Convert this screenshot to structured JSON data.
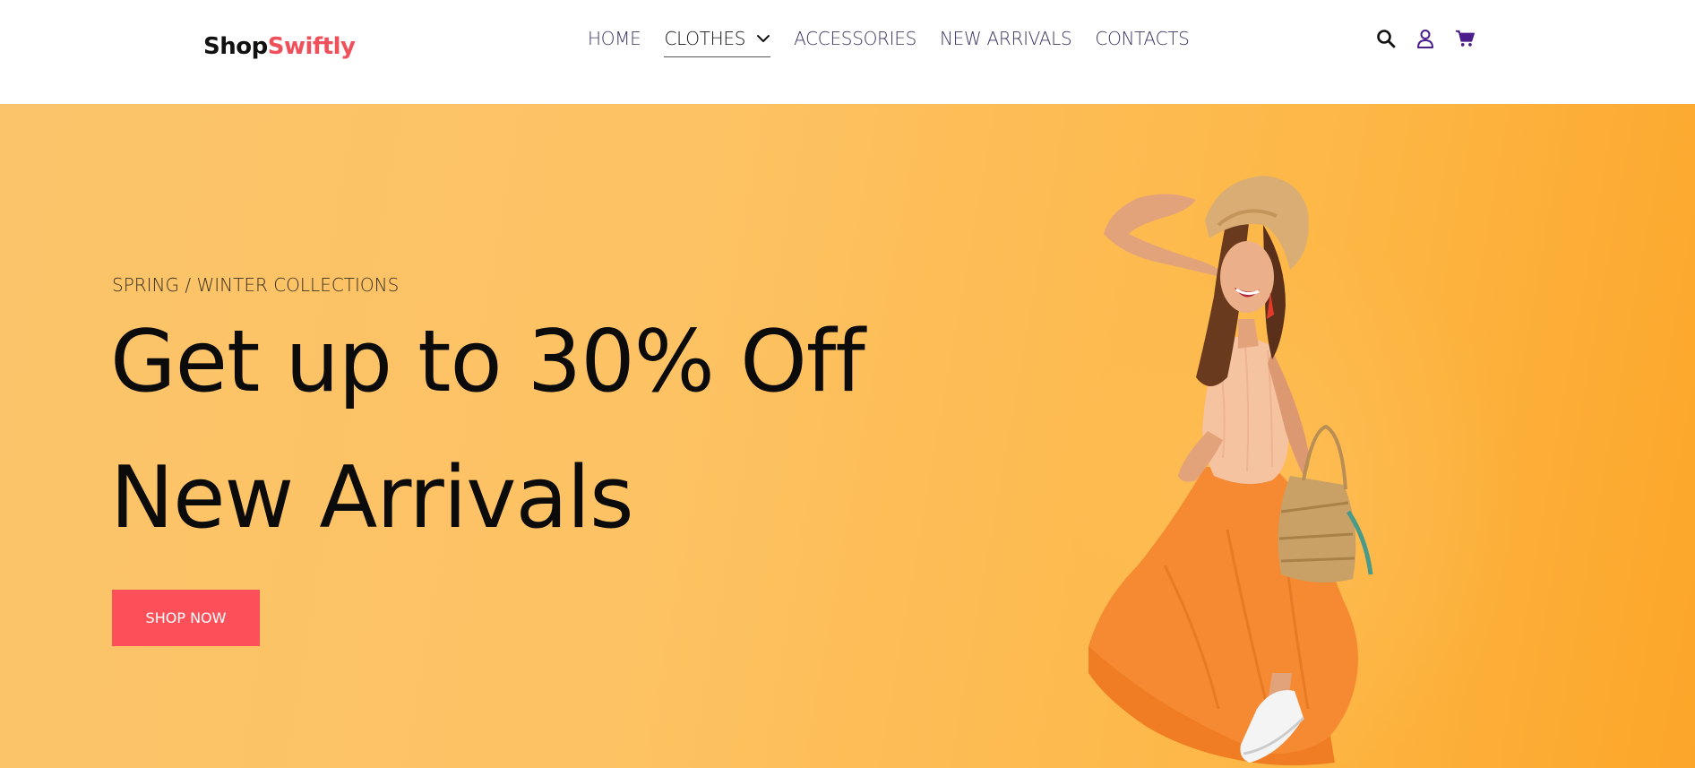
{
  "brand": {
    "part1": "Shop",
    "part2": "Swiftly",
    "color_dark": "#111111",
    "color_accent": "#f0505a"
  },
  "nav": {
    "items": [
      {
        "label": "HOME"
      },
      {
        "label": "CLOTHES",
        "active": true,
        "icon": "chevron-down-icon"
      },
      {
        "label": "ACCESSORIES"
      },
      {
        "label": "NEW ARRIVALS"
      },
      {
        "label": "CONTACTS"
      }
    ]
  },
  "tools": {
    "icons": [
      "search-icon",
      "user-icon",
      "cart-icon"
    ],
    "accent": "#4b1e8c"
  },
  "hero": {
    "eyebrow": "SPRING / WINTER COLLECTIONS",
    "headline_line1": "Get up to 30% Off",
    "headline_line2": "New Arrivals",
    "cta_label": "SHOP NOW",
    "background": "#fdbe5a",
    "cta_color": "#fb5059",
    "image": "smiling woman in orange skirt with straw hat and basket"
  }
}
